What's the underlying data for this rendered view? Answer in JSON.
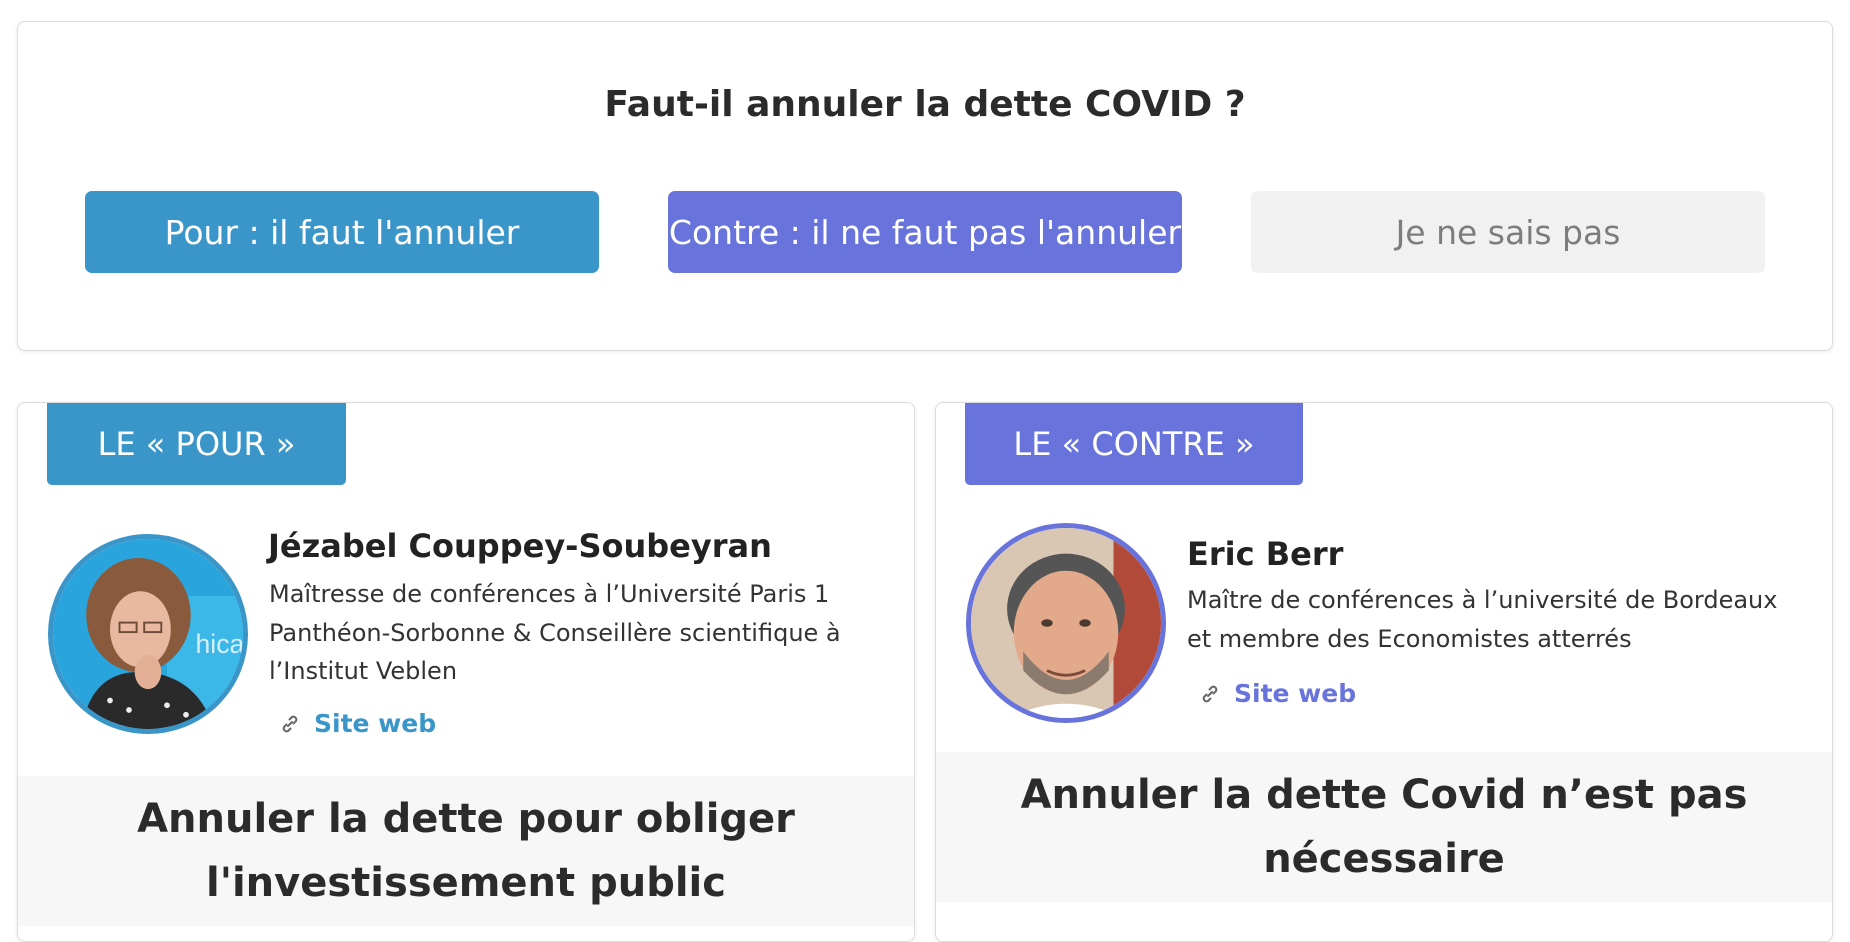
{
  "poll": {
    "question": "Faut-il annuler la dette COVID ?",
    "options": [
      {
        "label": "Pour : il faut l'annuler",
        "color": "#3a96c9"
      },
      {
        "label": "Contre : il ne faut pas l'annuler",
        "color": "#6874dc"
      },
      {
        "label": "Je ne sais pas",
        "color": "#f1f1f1"
      }
    ]
  },
  "pour": {
    "tab_label": "LE « POUR »",
    "author_name": "Jézabel Couppey-Soubeyran",
    "author_desc": "Maîtresse de conférences à l’Université Paris 1 Panthéon-Sorbonne & Conseillère scientifique à l’Institut Veblen",
    "link_label": "Site web",
    "link_icon": "link-icon",
    "article_title": "Annuler la dette pour obliger l'investissement public",
    "accent": "#3a96c9"
  },
  "contre": {
    "tab_label": "LE « CONTRE »",
    "author_name": "Eric Berr",
    "author_desc": "Maître de conférences à l’université de Bordeaux et membre des Economistes atterrés",
    "link_label": "Site web",
    "link_icon": "link-icon",
    "article_title": "Annuler la dette Covid n’est pas nécessaire",
    "accent": "#6874dc"
  }
}
